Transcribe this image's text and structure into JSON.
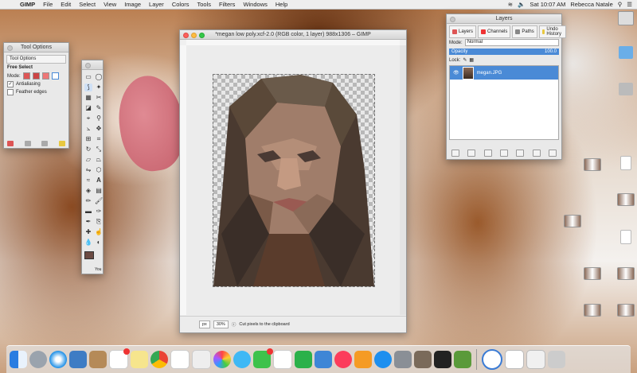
{
  "menubar": {
    "app": "GIMP",
    "items": [
      "File",
      "Edit",
      "Select",
      "View",
      "Image",
      "Layer",
      "Colors",
      "Tools",
      "Filters",
      "Windows",
      "Help"
    ],
    "clock": "Sat 10:07 AM",
    "user": "Rebecca Natale"
  },
  "tool_options": {
    "title": "Tool Options",
    "tab_label": "Tool Options",
    "tool_name": "Free Select",
    "mode_label": "Mode:",
    "antialiasing": "Antialiasing",
    "feather_edges": "Feather edges"
  },
  "image_window": {
    "title": "*megan low poly.xcf-2.0 (RGB color, 1 layer) 988x1306 – GIMP",
    "unit": "px",
    "zoom": "30%",
    "status_message": "Cut pixels to the clipboard"
  },
  "layers": {
    "title": "Layers",
    "tabs": [
      "Layers",
      "Channels",
      "Paths",
      "Undo History"
    ],
    "mode_label": "Mode:",
    "mode_value": "Normal",
    "opacity_label": "Opacity",
    "opacity_value": "100.0",
    "lock_label": "Lock:",
    "layer_name": "megan.JPG"
  },
  "toolbox": {
    "fg_bg_label": "You"
  },
  "colors": {
    "accent": "#4a8ad6"
  }
}
